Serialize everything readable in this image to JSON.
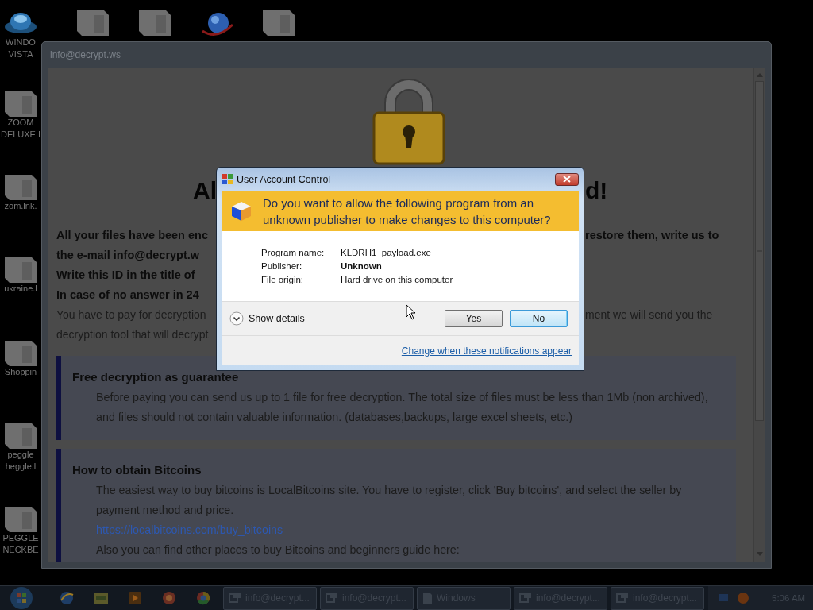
{
  "desktop": {
    "left_icons": [
      {
        "kind": "disc",
        "lines": [
          "WINDO",
          "VISTA"
        ]
      },
      {
        "kind": "file",
        "lines": [
          "ZOOM",
          "DELUXE.I"
        ]
      },
      {
        "kind": "file",
        "lines": [
          "zom.lnk."
        ]
      },
      {
        "kind": "file",
        "lines": [
          "ukraine.l"
        ]
      },
      {
        "kind": "file",
        "lines": [
          "Shoppin"
        ]
      },
      {
        "kind": "file",
        "lines": [
          "peggle",
          "heggle.l"
        ]
      },
      {
        "kind": "file",
        "lines": [
          "PEGGLE",
          "NECKBE"
        ]
      }
    ],
    "top_icons": [
      {
        "kind": "file"
      },
      {
        "kind": "file"
      },
      {
        "kind": "globe"
      },
      {
        "kind": "file"
      }
    ]
  },
  "window": {
    "title": "info@decrypt.ws",
    "heading": {
      "left": "Al",
      "right": "d!"
    },
    "lines": [
      {
        "left": "All your files have been enc",
        "right": "restore them, write us to",
        "bold": true
      },
      {
        "left": "the e-mail  info@decrypt.w",
        "bold": true
      },
      {
        "left": "Write this ID in the title of",
        "bold": true
      },
      {
        "left": "In case of no answer in 24",
        "bold": true
      },
      {
        "left": "You have to pay for decryption",
        "right": "ment we will send you the",
        "bold": false
      },
      {
        "left": "decryption tool that will decrypt",
        "bold": false
      }
    ],
    "boxes": [
      {
        "title": "Free decryption as guarantee",
        "parts": [
          {
            "kind": "text",
            "lines": [
              "Before paying you can send us up to 1 file for free decryption. The total size of files must be less than 1Mb (non archived),",
              "and files should not contain valuable information. (databases,backups, large excel sheets, etc.)"
            ]
          }
        ]
      },
      {
        "title": "How to obtain Bitcoins",
        "parts": [
          {
            "kind": "text",
            "lines": [
              "The easiest way to buy bitcoins is LocalBitcoins site. You have to register, click 'Buy bitcoins', and select the seller by",
              "payment method and price."
            ]
          },
          {
            "kind": "link",
            "lines": [
              "https://localbitcoins.com/buy_bitcoins"
            ]
          },
          {
            "kind": "text",
            "lines": [
              "Also you can find other places to buy Bitcoins and beginners guide here:"
            ]
          }
        ]
      }
    ]
  },
  "dialog": {
    "title": "User Account Control",
    "question": [
      "Do you want to allow the following program from an",
      "unknown publisher to make changes to this computer?"
    ],
    "fields": [
      {
        "label": "Program name:",
        "value": "KLDRH1_payload.exe",
        "bold": false
      },
      {
        "label": "Publisher:",
        "value": "Unknown",
        "bold": true
      },
      {
        "label": "File origin:",
        "value": "Hard drive on this computer",
        "bold": false
      }
    ],
    "show_details": "Show details",
    "buttons": [
      {
        "label": "Yes",
        "default": false
      },
      {
        "label": "No",
        "default": true
      }
    ],
    "link": "Change when these notifications appear"
  },
  "taskbar": {
    "quick_launch": [
      {
        "kind": "browser"
      },
      {
        "kind": "folder"
      },
      {
        "kind": "media"
      },
      {
        "kind": "app"
      },
      {
        "kind": "chrome"
      }
    ],
    "tasks": [
      {
        "label": "info@decrypt...",
        "kind": "app"
      },
      {
        "label": "info@decrypt...",
        "kind": "app"
      },
      {
        "label": "Windows",
        "kind": "document"
      },
      {
        "label": "info@decrypt...",
        "kind": "app"
      },
      {
        "label": "info@decrypt...",
        "kind": "app"
      }
    ],
    "time": "5:06 AM"
  }
}
